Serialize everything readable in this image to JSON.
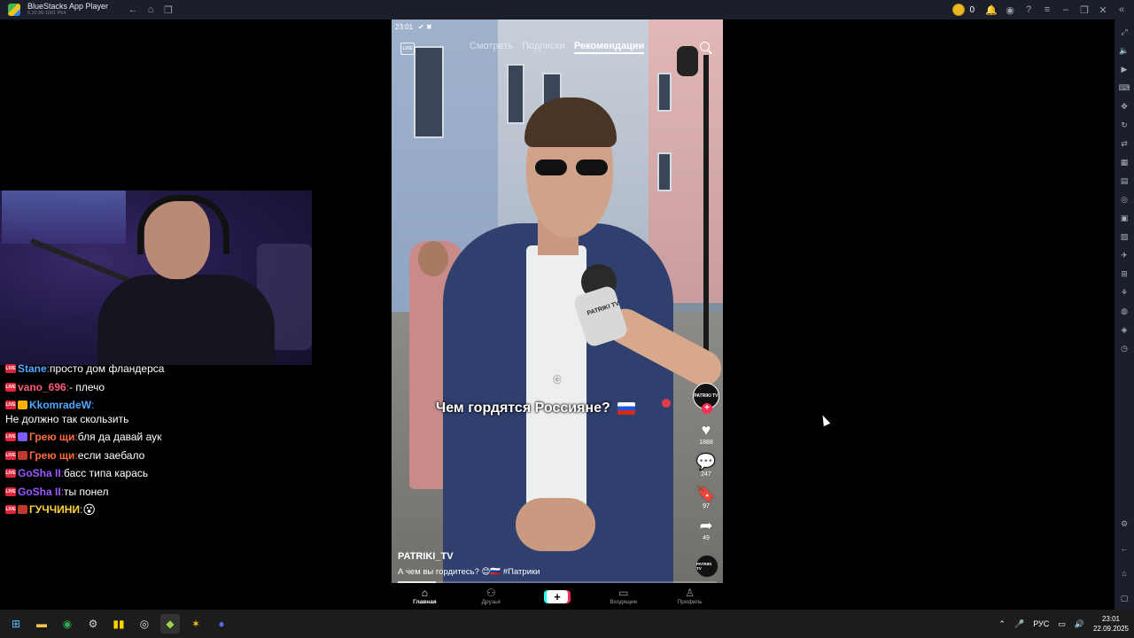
{
  "window": {
    "app_name": "BlueStacks App Player",
    "version": "5.22.86.1001 P64",
    "coin_count": "0"
  },
  "chat": [
    {
      "user": "Stane",
      "user_color": "#4fa8ff",
      "text": "просто дом фландерса"
    },
    {
      "user": "vano_696",
      "user_color": "#ff5a78",
      "text": "- плечо"
    },
    {
      "user": "KkomradeW",
      "user_color": "#4fa8ff",
      "text": "Не должно так скользить"
    },
    {
      "user": "Грею щи",
      "user_color": "#ff6a3d",
      "text": "бля да давай аук"
    },
    {
      "user": "Грею щи",
      "user_color": "#ff6a3d",
      "text": "если заебало"
    },
    {
      "user": "GoSha II",
      "user_color": "#9b59ff",
      "text": "басс типа карась"
    },
    {
      "user": "GoSha II",
      "user_color": "#9b59ff",
      "text": "ты понел"
    },
    {
      "user": "ГУЧЧИНИ",
      "user_color": "#ffd43b",
      "text": ""
    }
  ],
  "phone": {
    "status_time": "23:01",
    "tabs": [
      "Смотреть",
      "Подписки",
      "Рекомендации"
    ],
    "active_tab": "Рекомендации",
    "caption_letter": "С",
    "overlay_title": "Чем гордятся Россияне?",
    "mic_label": "PATRIKI TV",
    "avatar_label": "PATRIKI TV",
    "likes": "1888",
    "comments": "247",
    "saves": "97",
    "shares": "49",
    "video_user": "PATRIKI_TV",
    "video_desc": "А чем вы гордитесь? 😊🇷🇺 #Патрики",
    "progress": 0.12,
    "bottom_nav": [
      {
        "label": "Главная",
        "icon": "⌂"
      },
      {
        "label": "Друзья",
        "icon": "⚇"
      },
      {
        "label": "",
        "icon": "+"
      },
      {
        "label": "Входящие",
        "icon": "▭"
      },
      {
        "label": "Профиль",
        "icon": "♙"
      }
    ]
  },
  "taskbar": {
    "lang": "РУС",
    "time": "23:01",
    "date": "22.09.2025"
  }
}
